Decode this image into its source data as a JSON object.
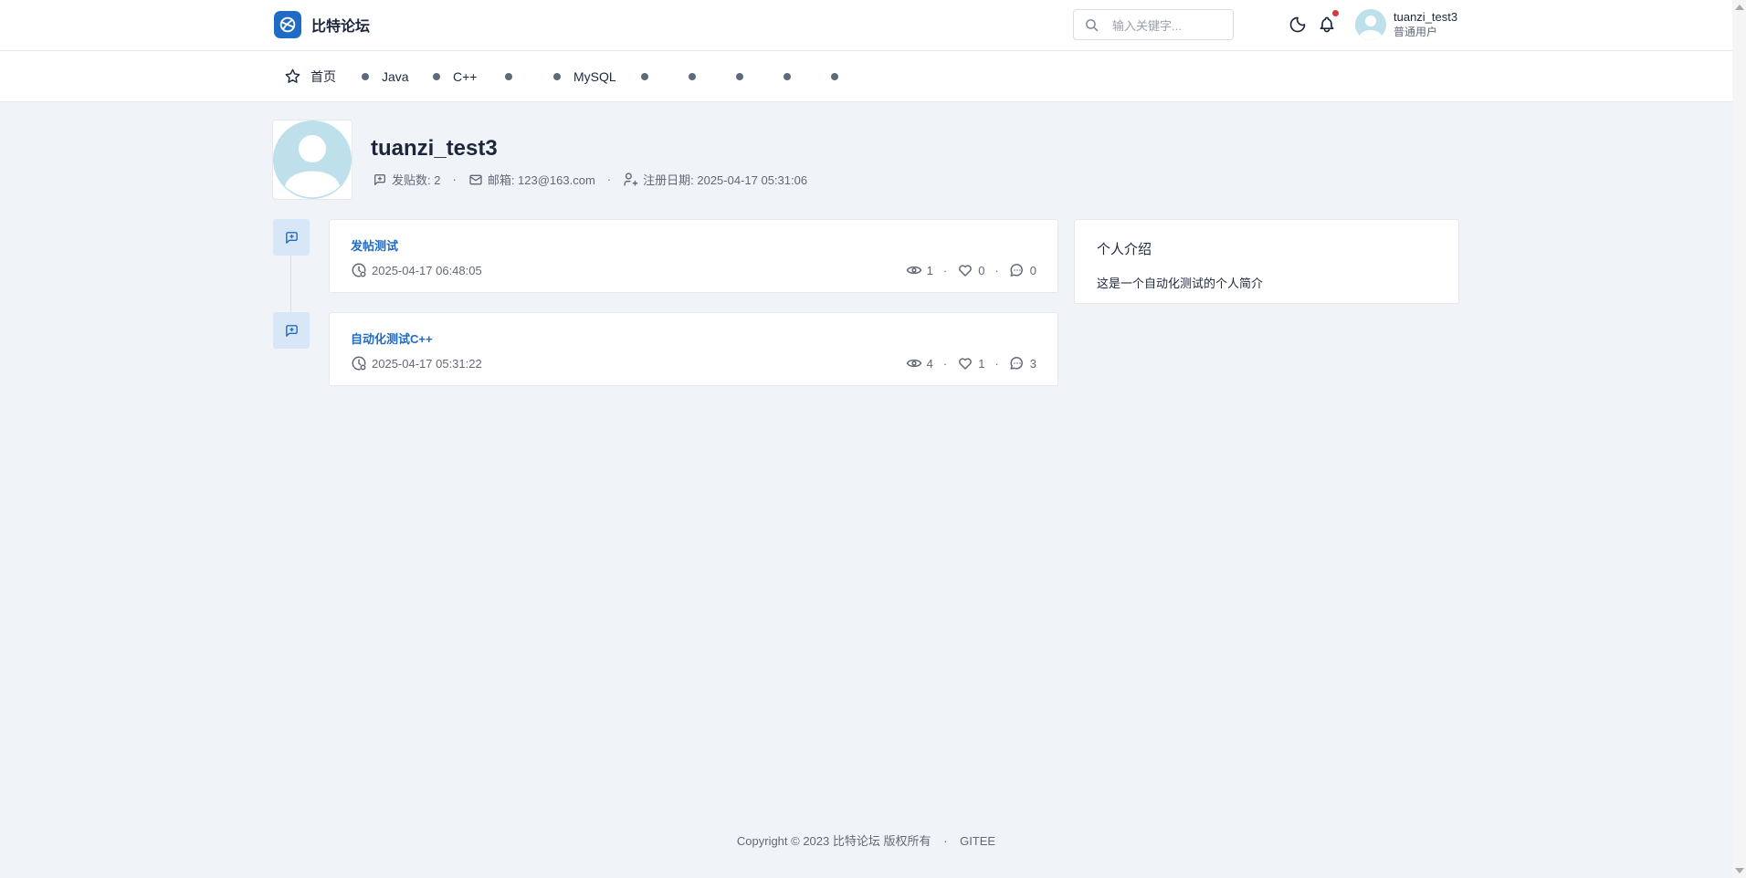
{
  "header": {
    "brand_name": "比特论坛",
    "search_placeholder": "输入关键字...",
    "user": {
      "name": "tuanzi_test3",
      "role": "普通用户"
    },
    "has_unread_notifications": true
  },
  "nav": {
    "items": [
      {
        "label": "首页",
        "icon": "star-icon"
      },
      {
        "label": "Java",
        "icon": "dot-icon"
      },
      {
        "label": "C++",
        "icon": "dot-icon"
      },
      {
        "label": "",
        "icon": "dot-icon"
      },
      {
        "label": "MySQL",
        "icon": "dot-icon"
      },
      {
        "label": "",
        "icon": "dot-icon"
      },
      {
        "label": "",
        "icon": "dot-icon"
      },
      {
        "label": "",
        "icon": "dot-icon"
      },
      {
        "label": "",
        "icon": "dot-icon"
      },
      {
        "label": "",
        "icon": "dot-icon"
      }
    ]
  },
  "profile": {
    "username": "tuanzi_test3",
    "post_count": "发贴数: 2",
    "email": "邮箱: 123@163.com",
    "registered": "注册日期: 2025-04-17 05:31:06"
  },
  "posts": [
    {
      "title": "发帖测试",
      "time": "2025-04-17 06:48:05",
      "views": "1",
      "likes": "0",
      "comments": "0"
    },
    {
      "title": "自动化测试C++",
      "time": "2025-04-17 05:31:22",
      "views": "4",
      "likes": "1",
      "comments": "3"
    }
  ],
  "intro": {
    "title": "个人介绍",
    "text": "这是一个自动化测试的个人简介"
  },
  "footer": {
    "copyright": "Copyright © 2023 比特论坛 版权所有",
    "separator": "·",
    "link": "GITEE"
  },
  "colors": {
    "accent": "#206bc4",
    "background": "#f0f3f8",
    "avatar_bg": "#bde0ea",
    "notification": "#d63939"
  }
}
